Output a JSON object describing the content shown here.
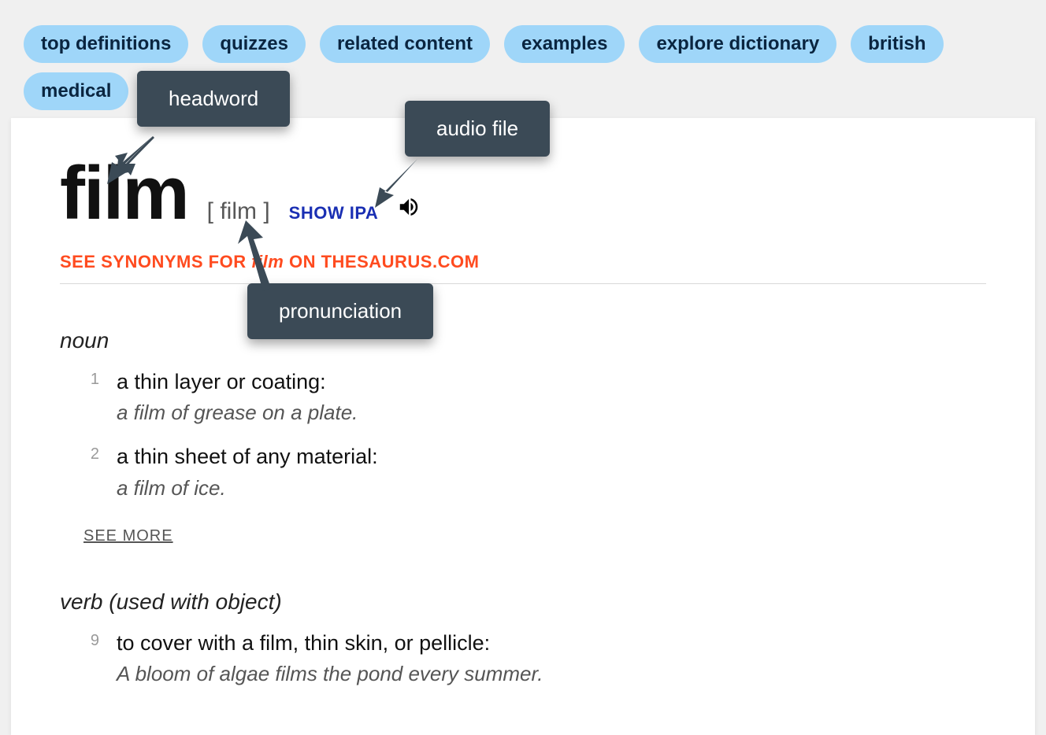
{
  "nav": {
    "pills": [
      "top definitions",
      "quizzes",
      "related content",
      "examples",
      "explore dictionary",
      "british",
      "medical"
    ]
  },
  "entry": {
    "headword": "film",
    "pronunciation": "[ film ]",
    "show_ipa_label": "SHOW IPA",
    "synonyms_prefix": "SEE SYNONYMS FOR ",
    "synonyms_word": "film",
    "synonyms_suffix": " ON THESAURUS.COM",
    "see_more": "SEE MORE",
    "pos1": "noun",
    "pos2": "verb (used with object)",
    "senses_noun": [
      {
        "num": "1",
        "def": "a thin layer or coating:",
        "ex": "a film of grease on a plate."
      },
      {
        "num": "2",
        "def": "a thin sheet of any material:",
        "ex": "a film of ice."
      }
    ],
    "senses_verb": [
      {
        "num": "9",
        "def": "to cover with a film, thin skin, or pellicle:",
        "ex": "A bloom of algae films the pond every summer."
      }
    ]
  },
  "callouts": {
    "headword": "headword",
    "audio": "audio file",
    "pron": "pronunciation"
  }
}
